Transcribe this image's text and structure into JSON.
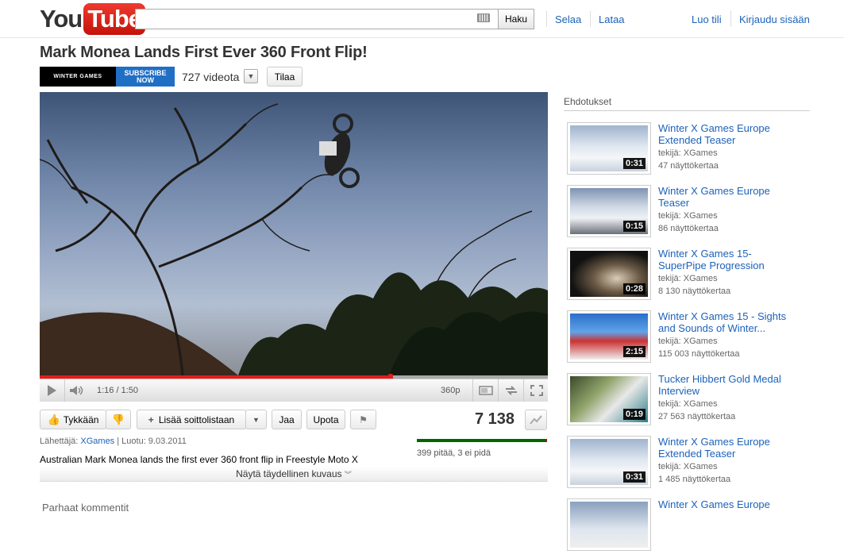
{
  "header": {
    "logo_you": "You",
    "logo_tube": "Tube",
    "search_value": "",
    "search_button": "Haku",
    "nav": [
      "Selaa",
      "Lataa"
    ],
    "account": [
      "Luo tili",
      "Kirjaudu sisään"
    ]
  },
  "video": {
    "title": "Mark Monea Lands First Ever 360 Front Flip!",
    "channel_banner_left": "WINTER GAMES",
    "channel_banner_x": "X",
    "channel_banner_right_1": "SUBSCRIBE",
    "channel_banner_right_2": "NOW",
    "video_count": "727 videota",
    "subscribe": "Tilaa",
    "time": "1:16 / 1:50",
    "quality": "360p",
    "progress_played": 0.69,
    "progress_buffered": 1.0
  },
  "actions": {
    "like": "Tykkään",
    "add_playlist": "Lisää soittolistaan",
    "share": "Jaa",
    "embed": "Upota",
    "views": "7 138"
  },
  "info": {
    "uploaded_by_label": "Lähettäjä:",
    "channel": "XGames",
    "created": "| Luotu: 9.03.2011",
    "rating_text": "399 pitää, 3 ei pidä",
    "rating_fraction": 0.9925,
    "description": "Australian Mark Monea lands the first ever 360 front flip in Freestyle Moto X",
    "show_more": "Näytä täydellinen kuvaus",
    "comments_heading": "Parhaat kommentit"
  },
  "sidebar": {
    "heading": "Ehdotukset",
    "items": [
      {
        "title": "Winter X Games Europe Extended Teaser",
        "by": "tekijä: XGames",
        "views": "47 näyttökertaa",
        "duration": "0:31"
      },
      {
        "title": "Winter X Games Europe Teaser",
        "by": "tekijä: XGames",
        "views": "86 näyttökertaa",
        "duration": "0:15"
      },
      {
        "title": "Winter X Games 15- SuperPipe Progression",
        "by": "tekijä: XGames",
        "views": "8 130 näyttökertaa",
        "duration": "0:28"
      },
      {
        "title": "Winter X Games 15 - Sights and Sounds of Winter...",
        "by": "tekijä: XGames",
        "views": "115 003 näyttökertaa",
        "duration": "2:15"
      },
      {
        "title": "Tucker Hibbert Gold Medal Interview",
        "by": "tekijä: XGames",
        "views": "27 563 näyttökertaa",
        "duration": "0:19"
      },
      {
        "title": "Winter X Games Europe Extended Teaser",
        "by": "tekijä: XGames",
        "views": "1 485 näyttökertaa",
        "duration": "0:31"
      },
      {
        "title": "Winter X Games Europe",
        "by": "",
        "views": "",
        "duration": ""
      }
    ]
  },
  "colors": {
    "link": "#1c62b9",
    "progress": "#e51b1b",
    "likes": "#006600",
    "dislikes": "#cc0000"
  }
}
